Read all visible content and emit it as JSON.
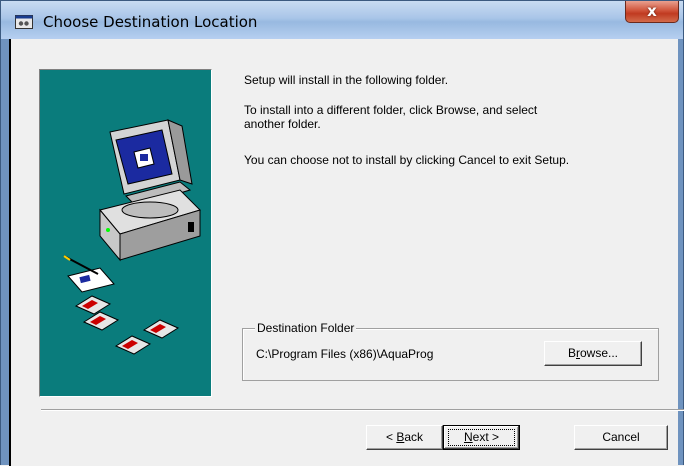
{
  "window": {
    "title": "Choose Destination Location",
    "close_glyph": "x",
    "icon": "setup-app-icon"
  },
  "messages": {
    "line1": "Setup will install  in the following folder.",
    "line2a": "To install into a different folder, click Browse, and select",
    "line2b": "another folder.",
    "line3": "You can choose not to install  by clicking Cancel to exit Setup."
  },
  "destination": {
    "legend": "Destination Folder",
    "path": "C:\\Program Files (x86)\\AquaProg",
    "browse_pre": "B",
    "browse_ul": "r",
    "browse_post": "owse..."
  },
  "buttons": {
    "back_pre": "< ",
    "back_ul": "B",
    "back_post": "ack",
    "next_ul": "N",
    "next_post": "ext >",
    "cancel": "Cancel"
  },
  "colors": {
    "panel": "#0a7c7c",
    "window_frame": "#6f93bf",
    "close_button": "#c03a20"
  }
}
